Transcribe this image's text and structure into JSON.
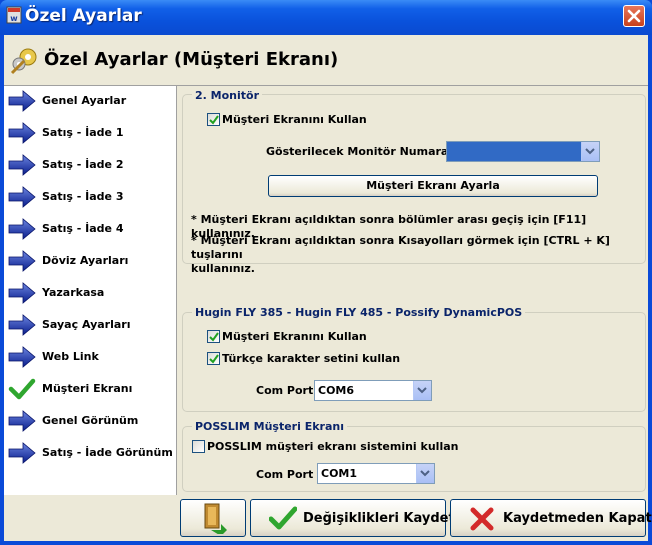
{
  "window": {
    "title": "Özel Ayarlar"
  },
  "header": {
    "title": "Özel Ayarlar (Müşteri Ekranı)"
  },
  "sidebar": {
    "items": [
      {
        "label": "Genel Ayarlar",
        "icon": "arrow-icon"
      },
      {
        "label": "Satış - İade 1",
        "icon": "arrow-icon"
      },
      {
        "label": "Satış - İade 2",
        "icon": "arrow-icon"
      },
      {
        "label": "Satış - İade 3",
        "icon": "arrow-icon"
      },
      {
        "label": "Satış - İade 4",
        "icon": "arrow-icon"
      },
      {
        "label": "Döviz Ayarları",
        "icon": "arrow-icon"
      },
      {
        "label": "Yazarkasa",
        "icon": "arrow-icon"
      },
      {
        "label": "Sayaç Ayarları",
        "icon": "arrow-icon"
      },
      {
        "label": "Web Link",
        "icon": "arrow-icon"
      },
      {
        "label": "Müşteri Ekranı",
        "icon": "checkmark-icon",
        "selected": true
      },
      {
        "label": "Genel Görünüm",
        "icon": "arrow-icon"
      },
      {
        "label": "Satış - İade Görünüm",
        "icon": "arrow-icon"
      }
    ]
  },
  "monitor": {
    "group_title": "2. Monitör",
    "use_checkbox_label": "Müşteri Ekranını Kullan",
    "use_checked": true,
    "monitor_no_label": "Gösterilecek Monitör Numarası",
    "monitor_no_value": "",
    "adjust_button": "Müşteri Ekranı Ayarla",
    "note1": "* Müşteri Ekranı  açıldıktan sonra bölümler arası geçiş için [F11] kullanınız.",
    "note2a": "* Müşteri Ekranı  açıldıktan sonra Kısayolları görmek için [CTRL + K] tuşlarını",
    "note2b": "kullanınız."
  },
  "hugin": {
    "group_title": "Hugin FLY 385 - Hugin FLY 485 - Possify DynamicPOS",
    "use_checkbox_label": "Müşteri Ekranını Kullan",
    "use_checked": true,
    "turkish_checkbox_label": "Türkçe karakter setini kullan",
    "turkish_checked": true,
    "com_port_label": "Com Port",
    "com_port_value": "COM6"
  },
  "posslim": {
    "group_title": "POSSLIM Müşteri Ekranı",
    "use_checkbox_label": "POSSLIM müşteri ekranı sistemini kullan",
    "use_checked": false,
    "com_port_label": "Com Port",
    "com_port_value": "COM1"
  },
  "footer": {
    "save_label": "Değişiklikleri Kaydet",
    "close_label": "Kaydetmeden Kapat"
  },
  "colors": {
    "titlebar": "#0a4ad8",
    "highlight": "#316ac5",
    "group_title": "#0a246a"
  }
}
